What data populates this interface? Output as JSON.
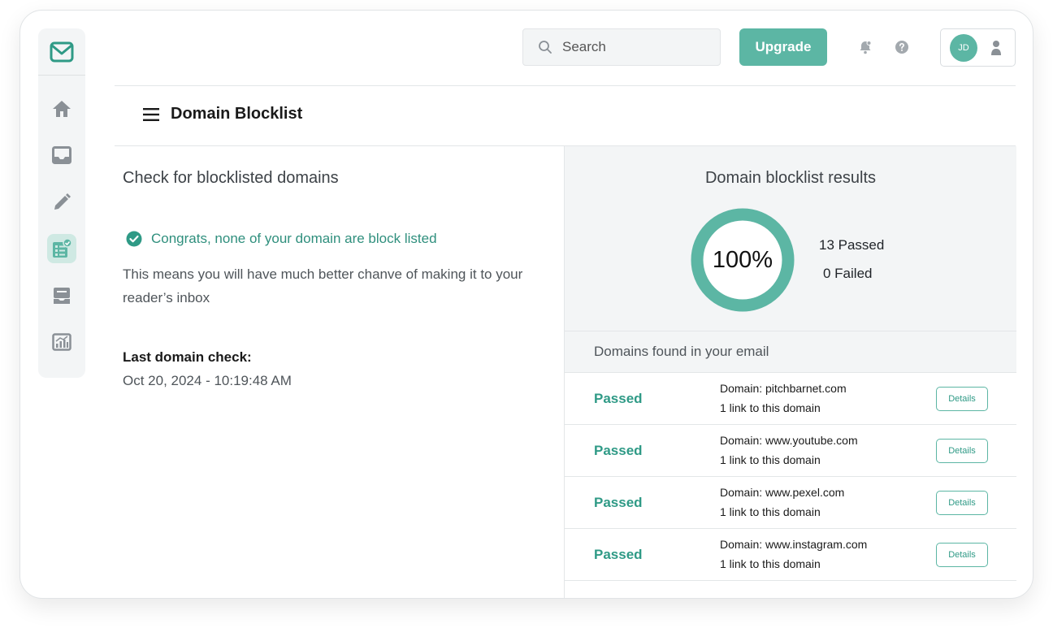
{
  "header": {
    "search_placeholder": "Search",
    "upgrade_label": "Upgrade",
    "avatar_initials": "JD"
  },
  "sidebar": {
    "items": [
      {
        "icon": "home-icon",
        "active": false
      },
      {
        "icon": "inbox-icon",
        "active": false
      },
      {
        "icon": "pencil-icon",
        "active": false
      },
      {
        "icon": "checklist-icon",
        "active": true
      },
      {
        "icon": "tray-icon",
        "active": false
      },
      {
        "icon": "analytics-icon",
        "active": false
      }
    ]
  },
  "page": {
    "title": "Domain Blocklist"
  },
  "left": {
    "heading": "Check for blocklisted domains",
    "congrats": "Congrats, none of your domain are block listed",
    "description": "This means you will have much better chanve of making it to your reader’s inbox",
    "last_check_label": "Last domain check:",
    "last_check_value": "Oct 20, 2024 - 10:19:48 AM"
  },
  "results": {
    "title": "Domain blocklist results",
    "percent_label": "100%",
    "percent_value": 100,
    "passed": "13 Passed",
    "failed": "0 Failed",
    "found_label": "Domains found in your email"
  },
  "domains": [
    {
      "status": "Passed",
      "domain": "Domain: pitchbarnet.com",
      "links": "1 link to this domain",
      "button": "Details"
    },
    {
      "status": "Passed",
      "domain": "Domain: www.youtube.com",
      "links": "1 link to this domain",
      "button": "Details"
    },
    {
      "status": "Passed",
      "domain": "Domain: www.pexel.com",
      "links": "1 link to this domain",
      "button": "Details"
    },
    {
      "status": "Passed",
      "domain": "Domain: www.instagram.com",
      "links": "1 link to this domain",
      "button": "Details"
    }
  ],
  "colors": {
    "accent": "#5cb6a4",
    "accent_dark": "#2f9a86",
    "panel_bg": "#f3f5f6"
  }
}
